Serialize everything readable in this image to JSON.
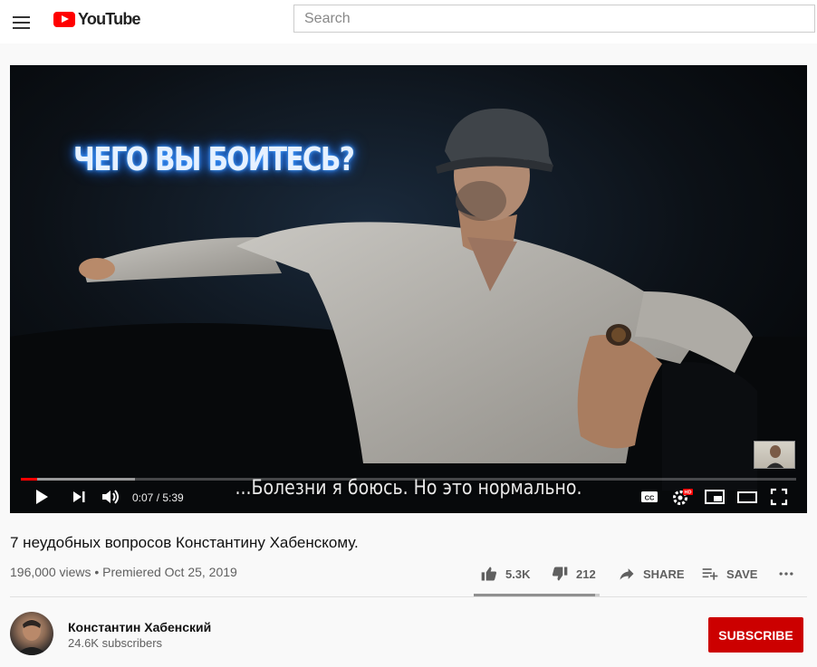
{
  "header": {
    "logo_text": "YouTube",
    "search_placeholder": "Search"
  },
  "player": {
    "overlay_title": "ЧЕГО ВЫ БОИТЕСЬ?",
    "subtitle": "...Болезни я боюсь. Но это нормально.",
    "time": "0:07 / 5:39",
    "played_fraction": 0.021,
    "loaded_fraction": 0.147,
    "hd_badge": "HD",
    "accent_color": "#ff0000"
  },
  "video": {
    "title": "7 неудобных вопросов Константину Хабенскому.",
    "meta": "196,000 views • Premiered Oct 25, 2019",
    "likes": "5.3K",
    "dislikes": "212",
    "like_ratio": 0.962,
    "share_label": "SHARE",
    "save_label": "SAVE"
  },
  "channel": {
    "name": "Константин Хабенский",
    "subscribers": "24.6K subscribers",
    "subscribe_label": "SUBSCRIBE",
    "subscribe_color": "#cc0000"
  }
}
